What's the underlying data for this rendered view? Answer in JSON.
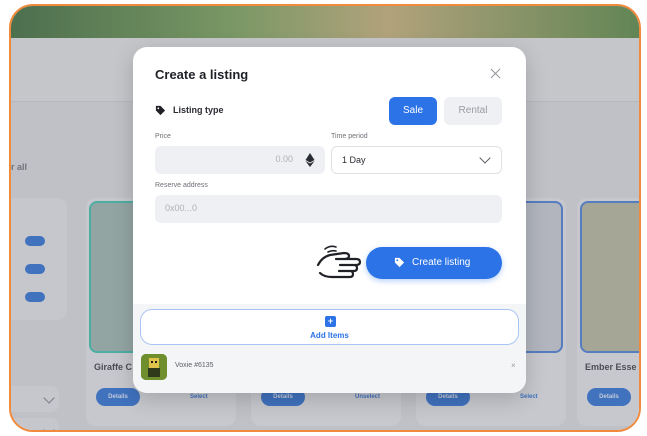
{
  "modal": {
    "title": "Create a listing",
    "listing_type_label": "Listing type",
    "type_options": [
      "Sale",
      "Rental"
    ],
    "selected_type": "Sale",
    "price_label": "Price",
    "price_value": "0.00",
    "time_period_label": "Time period",
    "time_period_value": "1 Day",
    "reserve_label": "Reserve address",
    "reserve_placeholder": "0x00...0",
    "create_button": "Create listing",
    "add_items_label": "Add Items",
    "items": [
      {
        "name": "Voxie #6135",
        "remove": "×"
      }
    ]
  },
  "background": {
    "clear_all": "r all",
    "cards": [
      {
        "title": "Giraffe C",
        "details": "Details",
        "action": "Select"
      },
      {
        "title": "",
        "details": "Details",
        "action": "Unselect"
      },
      {
        "title": "",
        "details": "Details",
        "action": "Select"
      },
      {
        "title": "Ember Esse",
        "details": "Details",
        "action": ""
      }
    ]
  },
  "colors": {
    "accent": "#2b73e6",
    "frame_border": "#f08a3c"
  }
}
